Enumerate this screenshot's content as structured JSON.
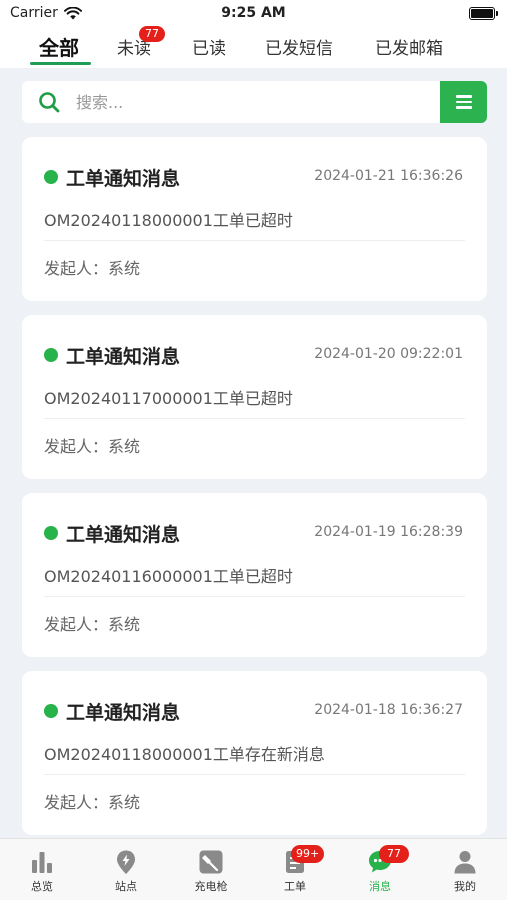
{
  "status_bar": {
    "carrier": "Carrier",
    "time": "9:25 AM"
  },
  "tabs": [
    {
      "label": "全部",
      "active": true
    },
    {
      "label": "未读",
      "badge": "77"
    },
    {
      "label": "已读"
    },
    {
      "label": "已发短信"
    },
    {
      "label": "已发邮箱"
    }
  ],
  "search": {
    "placeholder": "搜索..."
  },
  "colors": {
    "accent": "#2cb24f",
    "badge": "#e4201b"
  },
  "messages": [
    {
      "title": "工单通知消息",
      "time": "2024-01-21 16:36:26",
      "body": "OM20240118000001工单已超时",
      "sender": "发起人：系统"
    },
    {
      "title": "工单通知消息",
      "time": "2024-01-20 09:22:01",
      "body": "OM20240117000001工单已超时",
      "sender": "发起人：系统"
    },
    {
      "title": "工单通知消息",
      "time": "2024-01-19 16:28:39",
      "body": "OM20240116000001工单已超时",
      "sender": "发起人：系统"
    },
    {
      "title": "工单通知消息",
      "time": "2024-01-18 16:36:27",
      "body": "OM20240118000001工单存在新消息",
      "sender": "发起人：系统"
    }
  ],
  "bottom_nav": [
    {
      "label": "总览",
      "icon": "bar-chart-icon"
    },
    {
      "label": "站点",
      "icon": "location-pin-icon"
    },
    {
      "label": "充电枪",
      "icon": "charger-icon"
    },
    {
      "label": "工单",
      "icon": "document-icon",
      "badge": "99+"
    },
    {
      "label": "消息",
      "icon": "chat-icon",
      "badge": "77",
      "active": true
    },
    {
      "label": "我的",
      "icon": "user-icon"
    }
  ]
}
